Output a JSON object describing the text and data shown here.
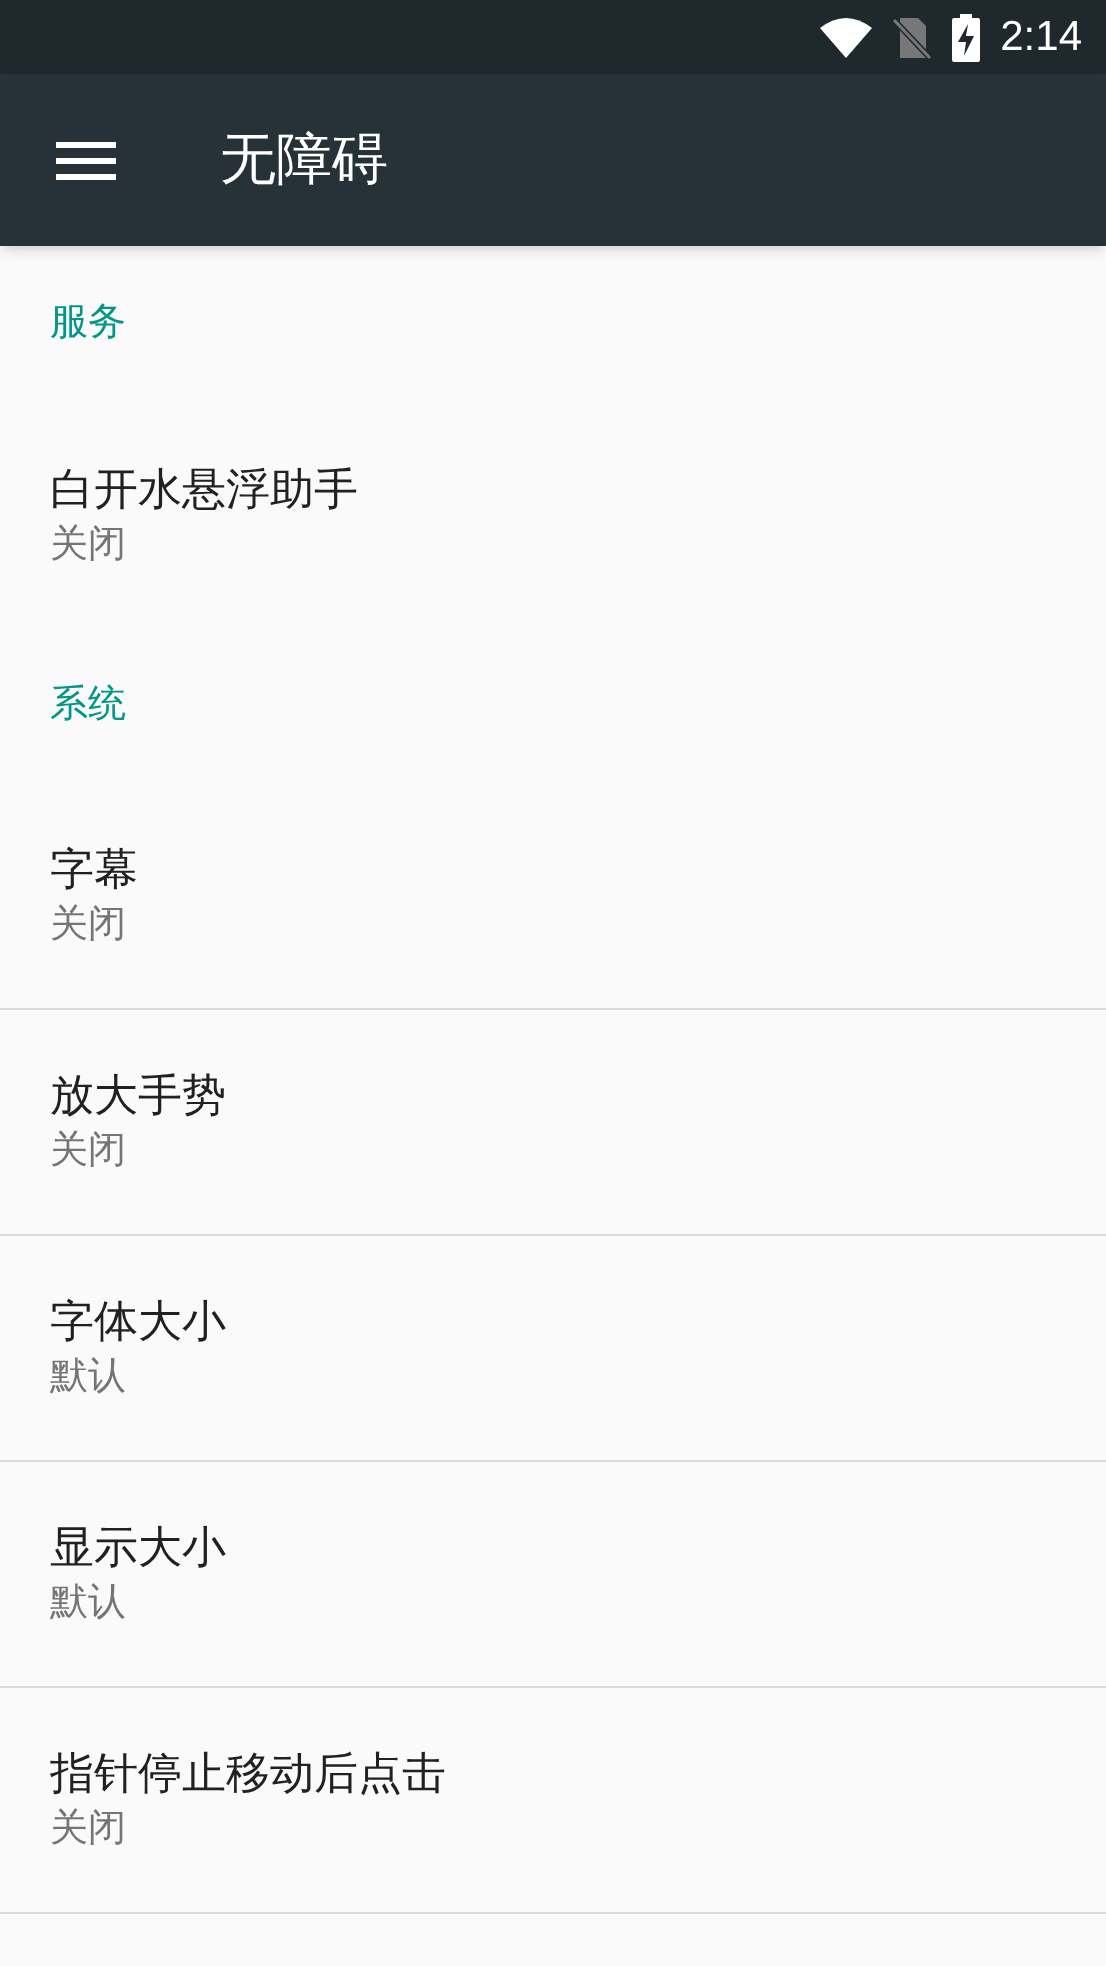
{
  "status_bar": {
    "time": "2:14"
  },
  "app_bar": {
    "title": "无障碍"
  },
  "sections": [
    {
      "title": "服务",
      "items": [
        {
          "title": "白开水悬浮助手",
          "summary": "关闭"
        }
      ]
    },
    {
      "title": "系统",
      "items": [
        {
          "title": "字幕",
          "summary": "关闭"
        },
        {
          "title": "放大手势",
          "summary": "关闭"
        },
        {
          "title": "字体大小",
          "summary": "默认"
        },
        {
          "title": "显示大小",
          "summary": "默认"
        },
        {
          "title": "指针停止移动后点击",
          "summary": "关闭"
        }
      ]
    }
  ]
}
